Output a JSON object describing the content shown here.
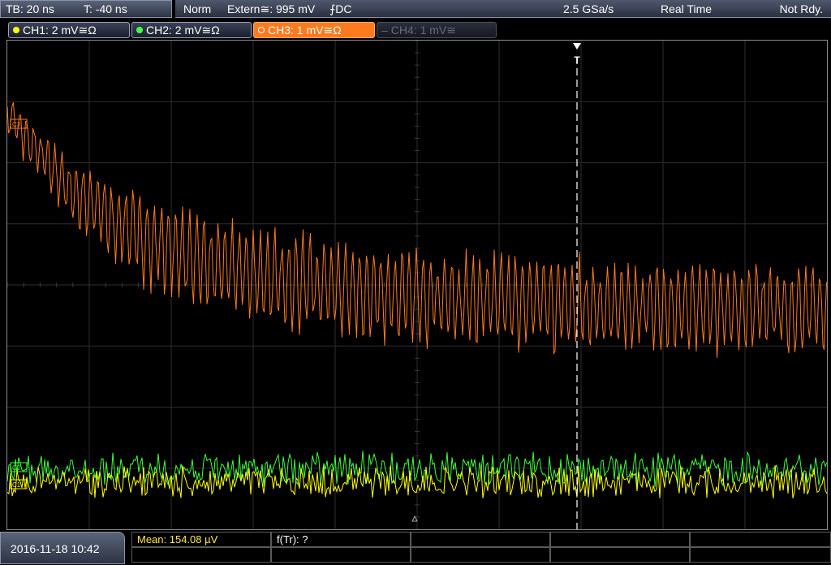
{
  "header": {
    "timebase": "TB: 20 ns",
    "trigger_offset": "T: -40 ns",
    "acq_mode": "Norm",
    "trigger_source": "Extern≅: 995 mV",
    "trigger_slope": "⨍DC",
    "sample_rate": "2.5 GSa/s",
    "real_time": "Real Time",
    "status": "Not Rdy."
  },
  "channels": [
    {
      "label": "CH1: 2 mV≅Ω",
      "color": "#ffff00",
      "active": true
    },
    {
      "label": "CH2: 2 mV≅Ω",
      "color": "#44ff44",
      "active": true
    },
    {
      "label": "CH3: 1 mV≅Ω",
      "color": "#ff7a1e",
      "active": true
    },
    {
      "label": "CH4: 1 mV≅",
      "color": "#666b78",
      "active": false
    }
  ],
  "screen": {
    "trigger_marker": "T",
    "ch3_marker": "C3",
    "ch2_marker": "C2",
    "ch1_marker": "C1"
  },
  "footer": {
    "datetime": "2016-11-18 10:42",
    "mean": "Mean: 154.08 µV",
    "ftr": "f(Tr): ?"
  }
}
